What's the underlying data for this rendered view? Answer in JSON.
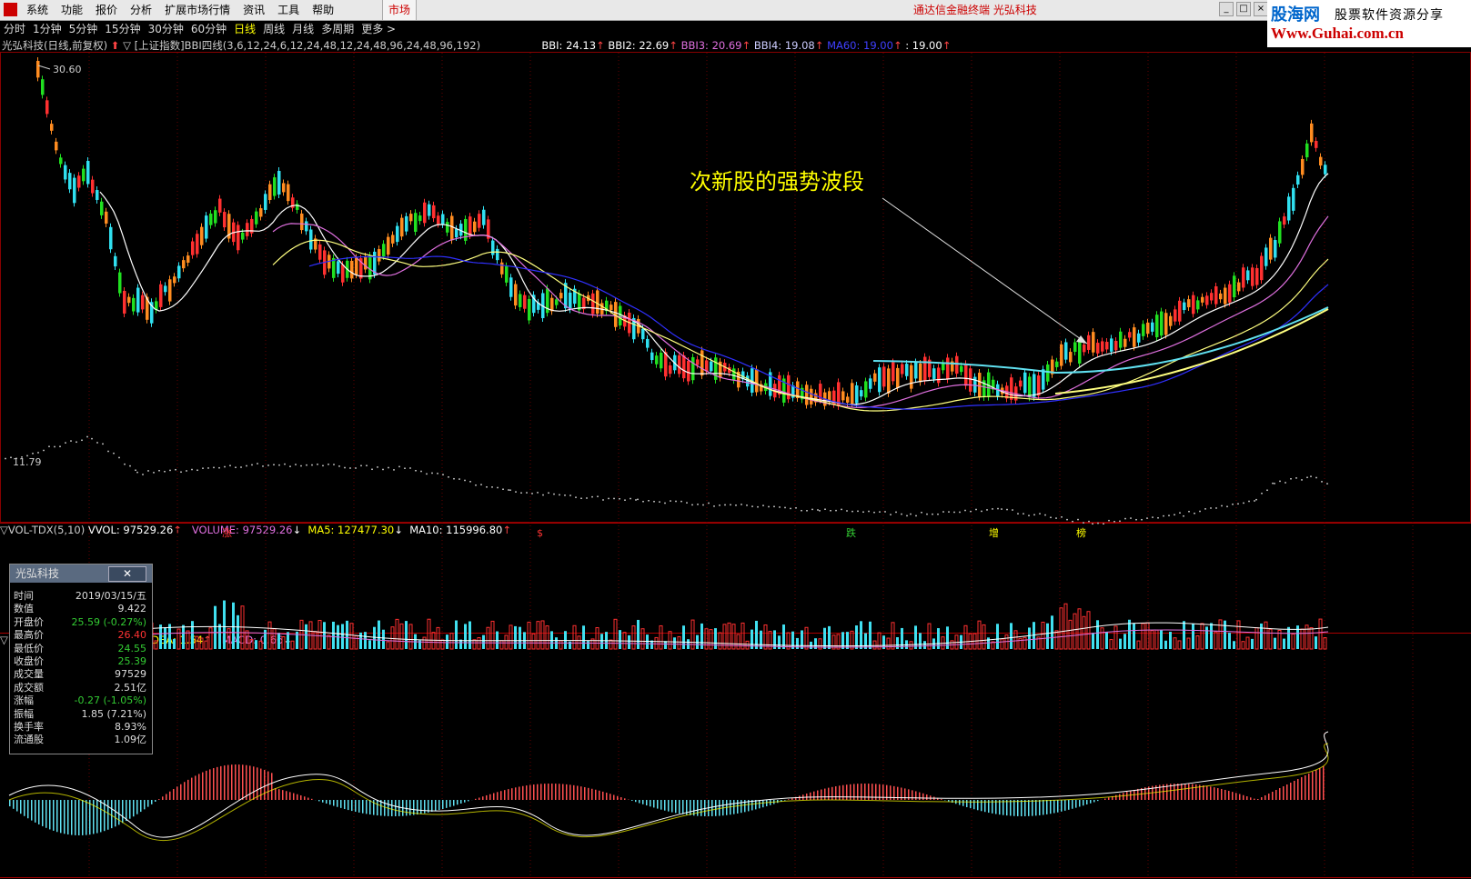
{
  "menu": {
    "items": [
      "系统",
      "功能",
      "报价",
      "分析",
      "扩展市场行情",
      "资讯",
      "工具",
      "帮助"
    ],
    "market": "市场",
    "title": "通达信金融终端 光弘科技"
  },
  "ad": {
    "name": "股海网",
    "slogan": "股票软件资源分享",
    "url": "Www.Guhai.com.cn"
  },
  "periods": [
    "分时",
    "1分钟",
    "5分钟",
    "15分钟",
    "30分钟",
    "60分钟",
    "日线",
    "周线",
    "月线",
    "多周期",
    "更多 >"
  ],
  "active_period": "日线",
  "main_info": {
    "stock": "光弘科技(日线,前复权)",
    "index": "[上证指数]",
    "indicator": "BBI四线(3,6,12,24,6,12,24,48,12,24,48,96,24,48,96,192)",
    "bbi": "BBI: 24.13",
    "bbi2": "BBI2: 22.69",
    "bbi3": "BBI3: 20.69",
    "bbi4": "BBI4: 19.08",
    "ma60": "MA60: 19.00",
    "extra": ": 19.00",
    "high_label": "30.60",
    "low_label": "11.79"
  },
  "vol_info": {
    "name": "VOL-TDX(5,10)",
    "vvol": "VVOL: 97529.26",
    "volume": "VOLUME: 97529.26",
    "ma5": "MA5: 127477.30",
    "ma10": "MA10: 115996.80"
  },
  "macd_info": {
    "dea": "DEA: 1.54",
    "macd": "MACD: 0.66"
  },
  "annotation": "次新股的强势波段",
  "markers": [
    "涨",
    "$",
    "跌",
    "增",
    "榜"
  ],
  "popup": {
    "title": "光弘科技",
    "close": "✕",
    "rows": [
      {
        "k": "时间",
        "v": "2019/03/15/五"
      },
      {
        "k": "数值",
        "v": "9.422"
      },
      {
        "k": "开盘价",
        "v": "25.59 (-0.27%)",
        "c": "#3c3"
      },
      {
        "k": "最高价",
        "v": "26.40",
        "c": "#f33"
      },
      {
        "k": "最低价",
        "v": "24.55",
        "c": "#3c3"
      },
      {
        "k": "收盘价",
        "v": "25.39",
        "c": "#3c3"
      },
      {
        "k": "成交量",
        "v": "97529"
      },
      {
        "k": "成交额",
        "v": "2.51亿"
      },
      {
        "k": "涨幅",
        "v": "-0.27 (-1.05%)",
        "c": "#3c3"
      },
      {
        "k": "振幅",
        "v": "1.85 (7.21%)"
      },
      {
        "k": "换手率",
        "v": "8.93%"
      },
      {
        "k": "流通股",
        "v": "1.09亿"
      }
    ]
  },
  "colors": {
    "up": "#ff3232",
    "down": "#00e000",
    "bbi": "#ffffff",
    "bbi2": "#e070e0",
    "bbi3": "#ffff80",
    "bbi4": "#3030ff",
    "ma60": "#60e0f0"
  }
}
